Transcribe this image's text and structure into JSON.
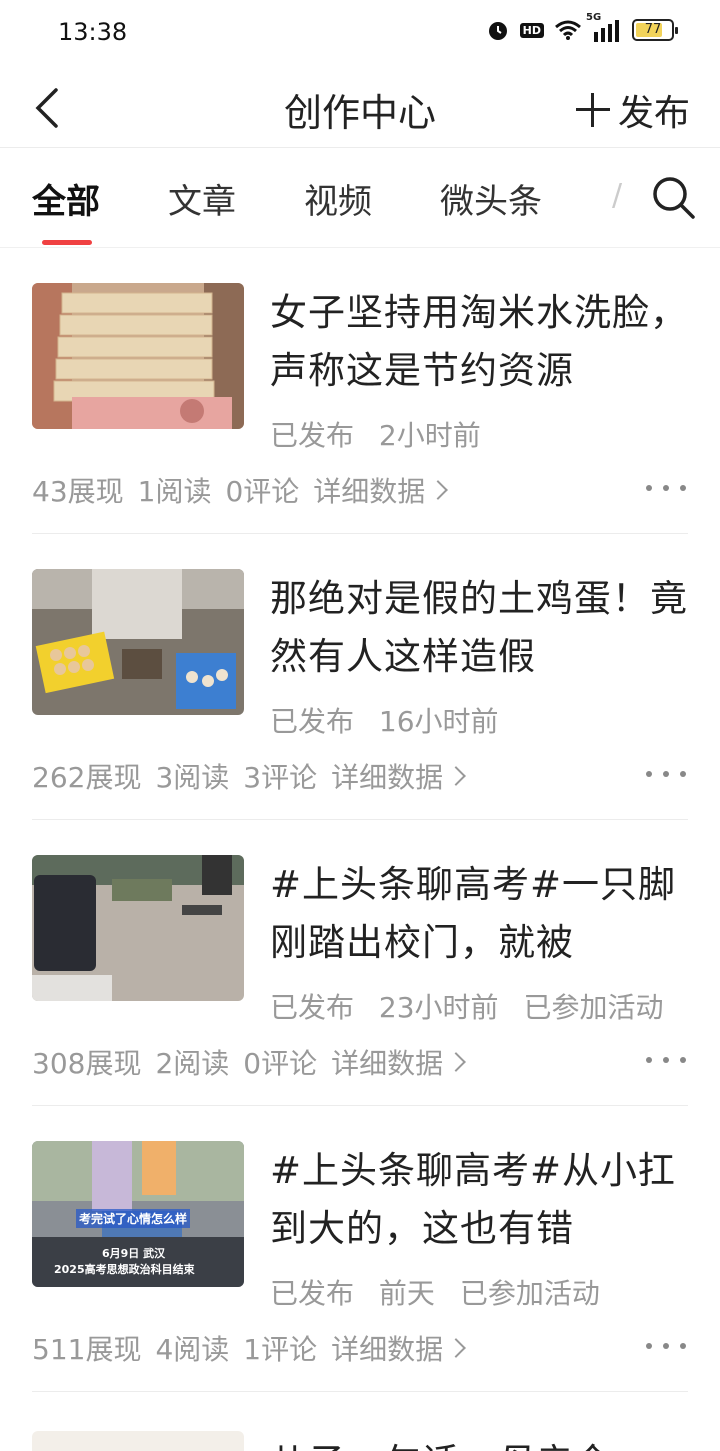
{
  "status": {
    "time": "13:38",
    "hd": "HD",
    "network": "5G",
    "battery": "77",
    "battery_level": 0.77
  },
  "header": {
    "title": "创作中心",
    "publish_label": "发布",
    "icons": [
      "back-icon",
      "plus-icon"
    ]
  },
  "tabs": {
    "items": [
      "全部",
      "文章",
      "视频",
      "微头条"
    ],
    "active_index": 0,
    "overflow_hint": "/",
    "accent_color": "#f04142"
  },
  "feed": [
    {
      "title": "女子坚持用淘米水洗脸，声称这是节约资源",
      "status": "已发布",
      "time": "2小时前",
      "activity": "",
      "impressions": "43展现",
      "reads": "1阅读",
      "comments": "0评论",
      "detail": "详细数据"
    },
    {
      "title": "那绝对是假的土鸡蛋！竟然有人这样造假",
      "status": "已发布",
      "time": "16小时前",
      "activity": "",
      "impressions": "262展现",
      "reads": "3阅读",
      "comments": "3评论",
      "detail": "详细数据"
    },
    {
      "title": "#上头条聊高考#一只脚刚踏出校门，就被",
      "status": "已发布",
      "time": "23小时前",
      "activity": "已参加活动",
      "impressions": "308展现",
      "reads": "2阅读",
      "comments": "0评论",
      "detail": "详细数据"
    },
    {
      "title": "#上头条聊高考#从小扛到大的，这也有错",
      "status": "已发布",
      "time": "前天",
      "activity": "已参加活动",
      "impressions": "511展现",
      "reads": "4阅读",
      "comments": "1评论",
      "detail": "详细数据",
      "thumb_caption_1": "考完试了心情怎么样",
      "thumb_caption_2": "6月9日 武汉",
      "thumb_caption_3": "2025高考思想政治科目结束"
    }
  ],
  "partial_item": {
    "title": "儿子一句话，母亲今"
  }
}
